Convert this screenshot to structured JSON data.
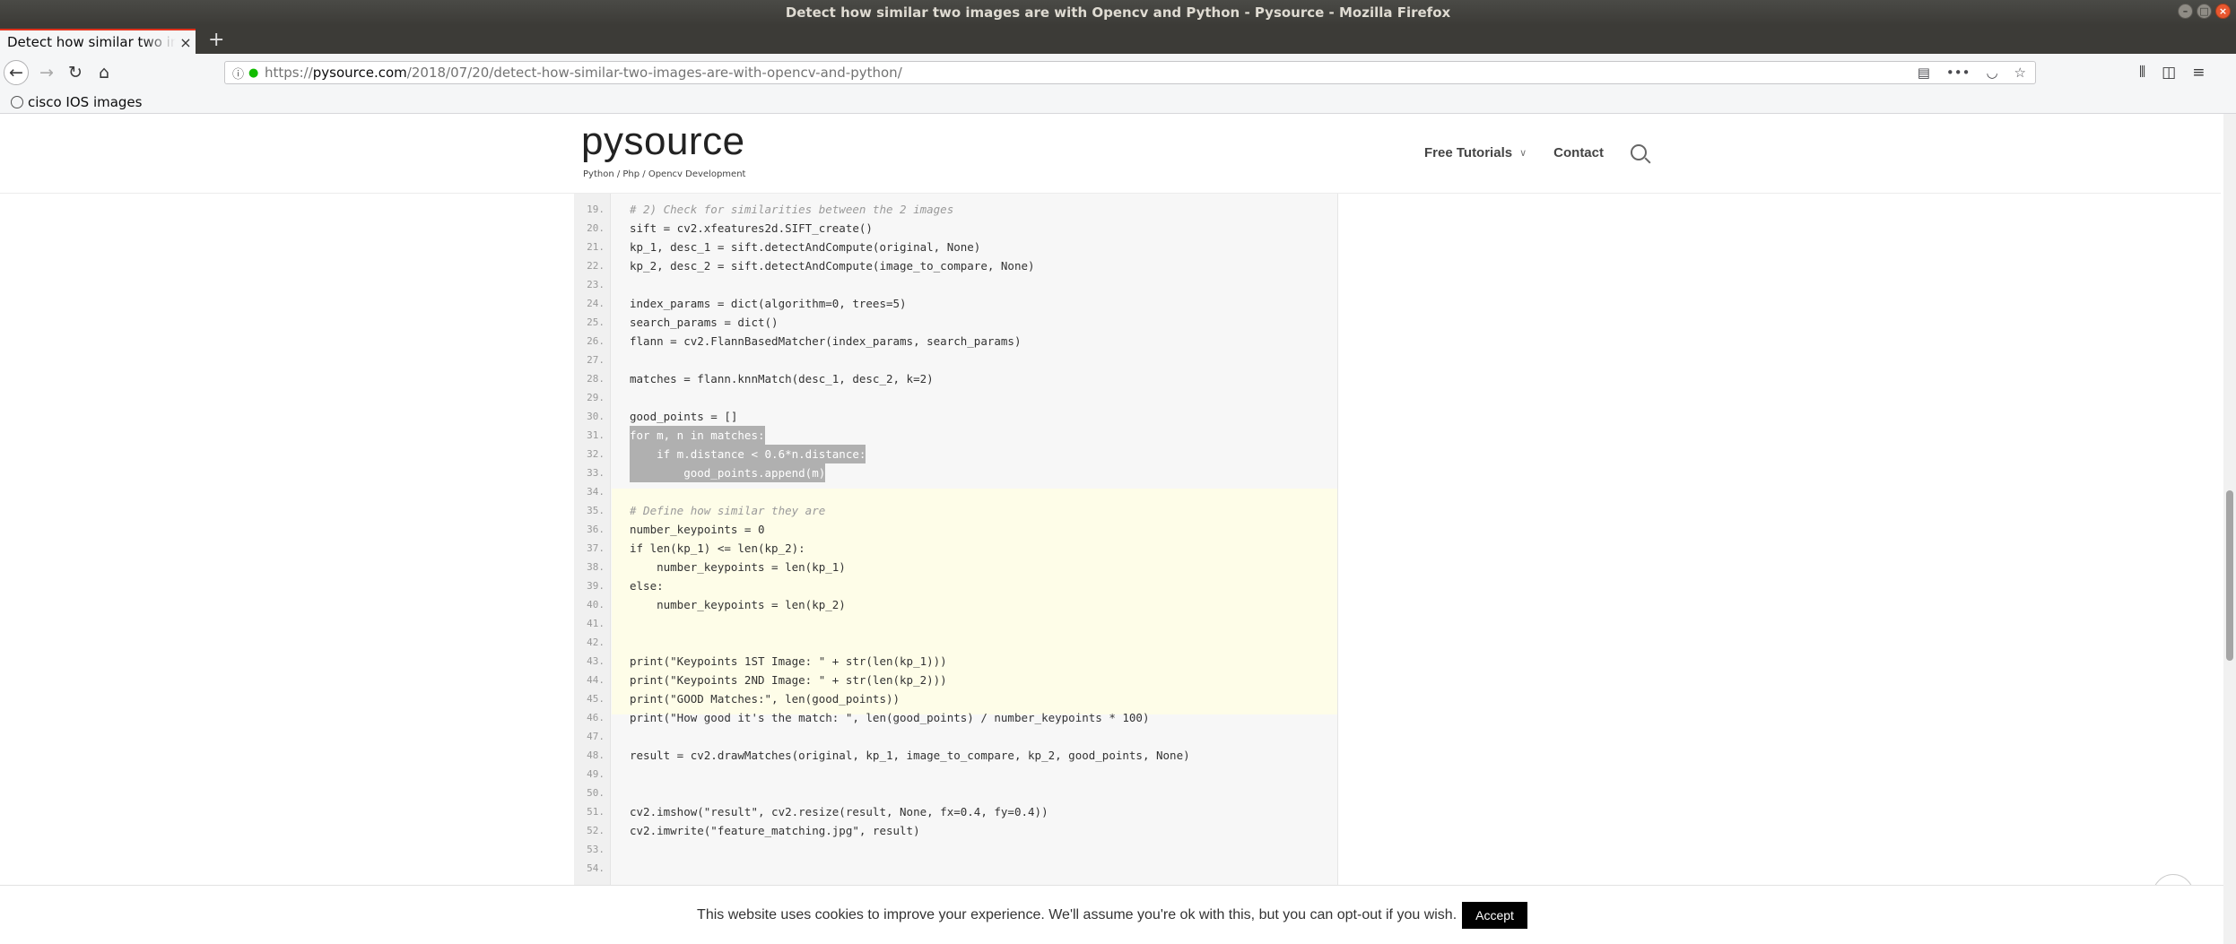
{
  "window": {
    "title": "Detect how similar two images are with Opencv and Python - Pysource - Mozilla Firefox"
  },
  "tab": {
    "title": "Detect how similar two images are with Opencv and Python - Pysource"
  },
  "url": {
    "scheme": "https://",
    "host": "pysource.com",
    "path": "/2018/07/20/detect-how-similar-two-images-are-with-opencv-and-python/"
  },
  "bookmarks": [
    {
      "label": "cisco IOS images"
    }
  ],
  "site": {
    "logo": "pysource",
    "tagline": "Python / Php / Opencv Development",
    "menu": [
      {
        "label": "Free Tutorials"
      },
      {
        "label": "Contact"
      }
    ]
  },
  "code": {
    "lines": [
      {
        "n": "19.",
        "text": "# 2) Check for similarities between the 2 images",
        "kind": "comment"
      },
      {
        "n": "20.",
        "text": "sift = cv2.xfeatures2d.SIFT_create()",
        "kind": "normal"
      },
      {
        "n": "21.",
        "text": "kp_1, desc_1 = sift.detectAndCompute(original, None)",
        "kind": "normal"
      },
      {
        "n": "22.",
        "text": "kp_2, desc_2 = sift.detectAndCompute(image_to_compare, None)",
        "kind": "normal"
      },
      {
        "n": "23.",
        "text": "",
        "kind": "normal"
      },
      {
        "n": "24.",
        "text": "index_params = dict(algorithm=0, trees=5)",
        "kind": "normal"
      },
      {
        "n": "25.",
        "text": "search_params = dict()",
        "kind": "normal"
      },
      {
        "n": "26.",
        "text": "flann = cv2.FlannBasedMatcher(index_params, search_params)",
        "kind": "normal"
      },
      {
        "n": "27.",
        "text": "",
        "kind": "normal"
      },
      {
        "n": "28.",
        "text": "matches = flann.knnMatch(desc_1, desc_2, k=2)",
        "kind": "normal"
      },
      {
        "n": "29.",
        "text": "",
        "kind": "normal"
      },
      {
        "n": "30.",
        "text": "good_points = []",
        "kind": "normal"
      },
      {
        "n": "31.",
        "text": "for m, n in matches:",
        "kind": "selected"
      },
      {
        "n": "32.",
        "text": "    if m.distance < 0.6*n.distance:",
        "kind": "selected"
      },
      {
        "n": "33.",
        "text": "        good_points.append(m)",
        "kind": "selected"
      },
      {
        "n": "34.",
        "text": "",
        "kind": "normal"
      },
      {
        "n": "35.",
        "text": "# Define how similar they are",
        "kind": "comment"
      },
      {
        "n": "36.",
        "text": "number_keypoints = 0",
        "kind": "normal"
      },
      {
        "n": "37.",
        "text": "if len(kp_1) <= len(kp_2):",
        "kind": "normal"
      },
      {
        "n": "38.",
        "text": "    number_keypoints = len(kp_1)",
        "kind": "normal"
      },
      {
        "n": "39.",
        "text": "else:",
        "kind": "normal"
      },
      {
        "n": "40.",
        "text": "    number_keypoints = len(kp_2)",
        "kind": "normal"
      },
      {
        "n": "41.",
        "text": "",
        "kind": "normal"
      },
      {
        "n": "42.",
        "text": "",
        "kind": "normal"
      },
      {
        "n": "43.",
        "text": "print(\"Keypoints 1ST Image: \" + str(len(kp_1)))",
        "kind": "normal"
      },
      {
        "n": "44.",
        "text": "print(\"Keypoints 2ND Image: \" + str(len(kp_2)))",
        "kind": "normal"
      },
      {
        "n": "45.",
        "text": "print(\"GOOD Matches:\", len(good_points))",
        "kind": "normal"
      },
      {
        "n": "46.",
        "text": "print(\"How good it's the match: \", len(good_points) / number_keypoints * 100)",
        "kind": "normal"
      },
      {
        "n": "47.",
        "text": "",
        "kind": "normal"
      },
      {
        "n": "48.",
        "text": "result = cv2.drawMatches(original, kp_1, image_to_compare, kp_2, good_points, None)",
        "kind": "normal"
      },
      {
        "n": "49.",
        "text": "",
        "kind": "normal"
      },
      {
        "n": "50.",
        "text": "",
        "kind": "normal"
      },
      {
        "n": "51.",
        "text": "cv2.imshow(\"result\", cv2.resize(result, None, fx=0.4, fy=0.4))",
        "kind": "normal"
      },
      {
        "n": "52.",
        "text": "cv2.imwrite(\"feature_matching.jpg\", result)",
        "kind": "normal"
      },
      {
        "n": "53.",
        "text": "",
        "kind": "normal"
      },
      {
        "n": "54.",
        "text": "",
        "kind": "normal"
      }
    ]
  },
  "cookie": {
    "text": "This website uses cookies to improve your experience. We'll assume you're ok with this, but you can opt-out if you wish.",
    "accept": "Accept"
  }
}
